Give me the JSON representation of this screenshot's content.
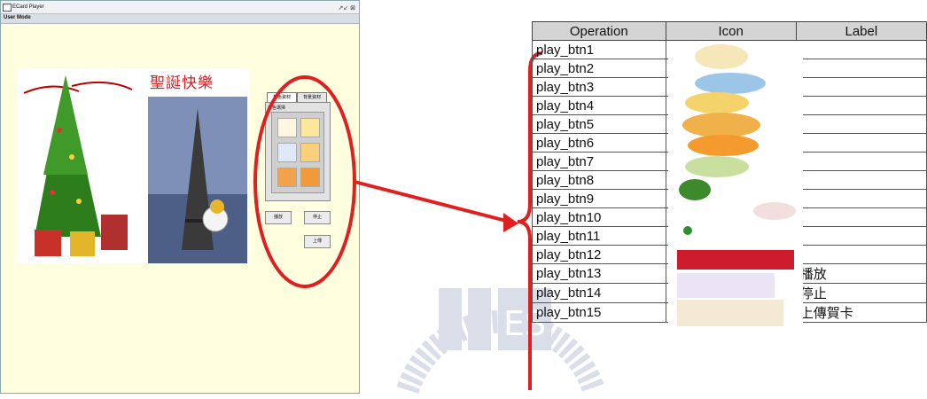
{
  "window": {
    "title": "ECard Player",
    "menu": "User Mode",
    "controls": "↗↙ ⊠"
  },
  "canvas": {
    "title_cn": "聖誕快樂"
  },
  "panel": {
    "tabs": [
      "角色資材",
      "背景資材"
    ],
    "label": "角色選擇",
    "buttons": {
      "play": "播放",
      "stop": "停止",
      "upload": "上傳"
    }
  },
  "table": {
    "headers": [
      "Operation",
      "Icon",
      "Label"
    ],
    "rows": [
      {
        "op": "play_btn1",
        "label": ""
      },
      {
        "op": "play_btn2",
        "label": ""
      },
      {
        "op": "play_btn3",
        "label": ""
      },
      {
        "op": "play_btn4",
        "label": ""
      },
      {
        "op": "play_btn5",
        "label": ""
      },
      {
        "op": "play_btn6",
        "label": ""
      },
      {
        "op": "play_btn7",
        "label": ""
      },
      {
        "op": "play_btn8",
        "label": ""
      },
      {
        "op": "play_btn9",
        "label": ""
      },
      {
        "op": "play_btn10",
        "label": ""
      },
      {
        "op": "play_btn11",
        "label": ""
      },
      {
        "op": "play_btn12",
        "label": ""
      },
      {
        "op": "play_btn13",
        "label": "播放"
      },
      {
        "op": "play_btn14",
        "label": "停止"
      },
      {
        "op": "play_btn15",
        "label": "上傳賀卡"
      }
    ]
  },
  "watermark": {
    "text": "ES"
  },
  "colors": {
    "callout": "#e02020",
    "window_bg": "#ffffe0",
    "header_bg": "#d4d4d4"
  }
}
